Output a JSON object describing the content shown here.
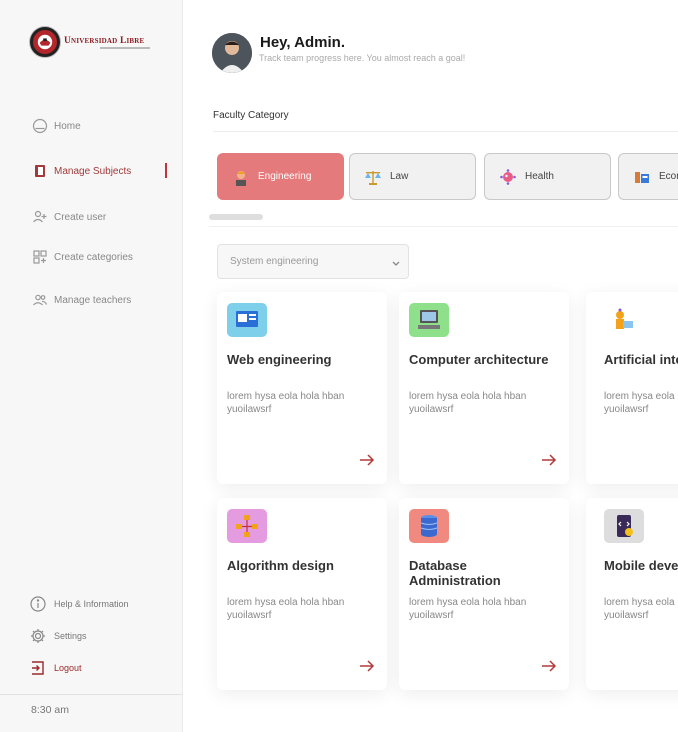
{
  "brand": {
    "name": "Universidad Libre",
    "colors": {
      "primary": "#a13a3a",
      "accent": "#e57a7c"
    }
  },
  "sidebar": {
    "items": [
      {
        "label": "Home",
        "icon": "home-icon"
      },
      {
        "label": "Manage Subjects",
        "icon": "book-icon",
        "active": true
      },
      {
        "label": "Create user",
        "icon": "user-plus-icon"
      },
      {
        "label": "Create categories",
        "icon": "grid-plus-icon"
      },
      {
        "label": "Manage teachers",
        "icon": "users-icon"
      }
    ],
    "bottom": [
      {
        "label": "Help & Information",
        "icon": "info-icon"
      },
      {
        "label": "Settings",
        "icon": "gear-icon"
      },
      {
        "label": "Logout",
        "icon": "logout-icon"
      }
    ],
    "time": "8:30 am"
  },
  "header": {
    "greeting": "Hey, Admin.",
    "subtitle": "Track team progress here. You almost reach a goal!"
  },
  "faculty": {
    "label": "Faculty Category",
    "categories": [
      {
        "label": "Engineering",
        "active": true
      },
      {
        "label": "Law"
      },
      {
        "label": "Health"
      },
      {
        "label": "Econ"
      }
    ]
  },
  "filter": {
    "selected": "System engineering"
  },
  "cards": [
    {
      "title": "Web engineering",
      "desc": "lorem hysa eola hola hban yuoilawsrf",
      "color": "#7ed0ea"
    },
    {
      "title": "Computer architecture",
      "desc": "lorem hysa eola hola hban yuoilawsrf",
      "color": "#8ee08a"
    },
    {
      "title": "Artificial intelligence",
      "desc": "lorem hysa eola hola hban yuoilawsrf",
      "color": "#ffffff"
    },
    {
      "title": "Algorithm design",
      "desc": "lorem hysa eola hola hban yuoilawsrf",
      "color": "#e59be0"
    },
    {
      "title": "Database Administration",
      "desc": "lorem hysa eola hola hban yuoilawsrf",
      "color": "#f08a80"
    },
    {
      "title": "Mobile development",
      "desc": "lorem hysa eola hola hban yuoilawsrf",
      "color": "#dddddd"
    }
  ]
}
